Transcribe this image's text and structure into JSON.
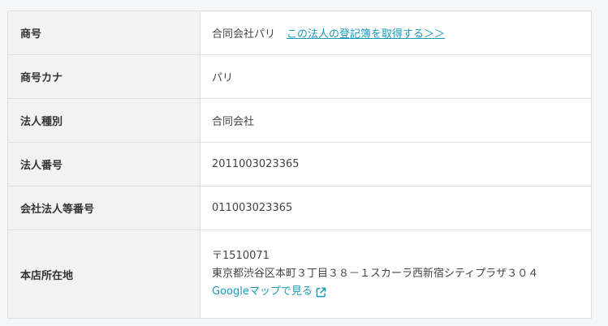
{
  "rows": [
    {
      "label": "商号",
      "value": "合同会社パリ",
      "link": "この法人の登記簿を取得する＞＞"
    },
    {
      "label": "商号カナ",
      "value": "パリ"
    },
    {
      "label": "法人種別",
      "value": "合同会社"
    },
    {
      "label": "法人番号",
      "value": "2011003023365"
    },
    {
      "label": "会社法人等番号",
      "value": "011003023365"
    },
    {
      "label": "本店所在地",
      "postal": "〒1510071",
      "address": "東京都渋谷区本町３丁目３８－１スカーラ西新宿シティプラザ３０４",
      "map_link": "Googleマップで見る",
      "map_icon": "external-link-icon"
    }
  ],
  "colors": {
    "accent": "#1a9ab8",
    "label_bg": "#f2f2f2",
    "border": "#dddddd"
  }
}
